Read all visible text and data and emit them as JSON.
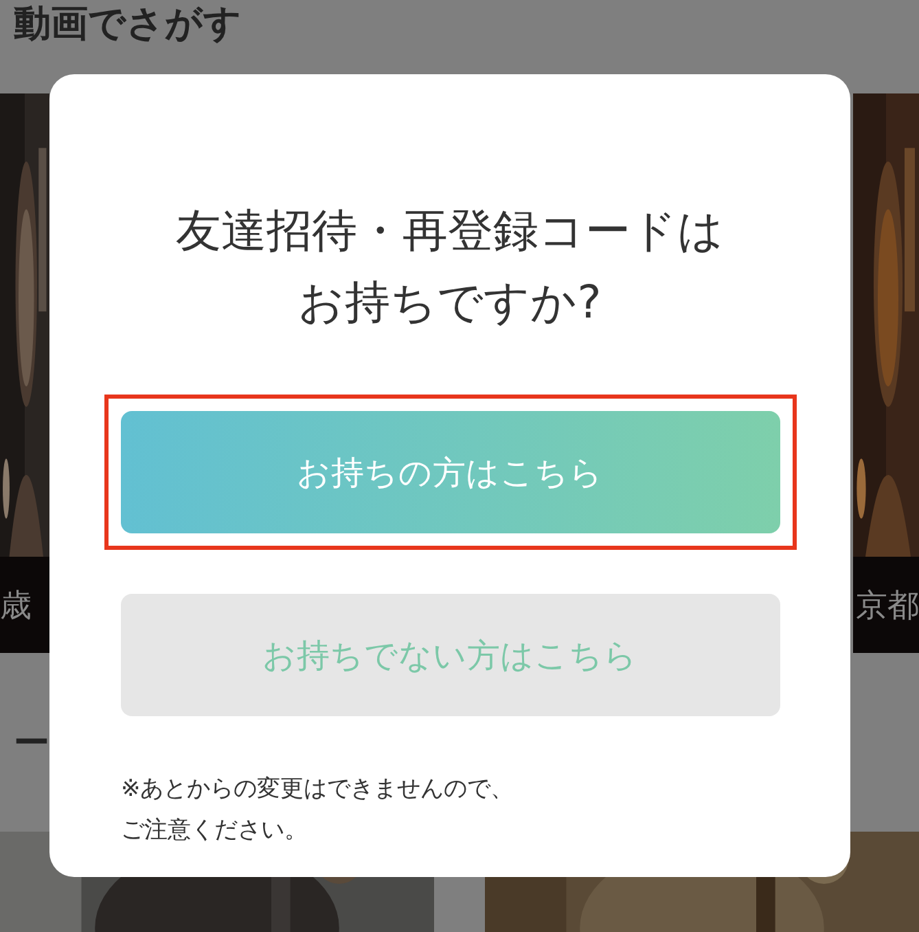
{
  "page": {
    "section_title": "動画でさがす",
    "cards": [
      {
        "caption": "歳"
      },
      {
        "caption": "京都"
      }
    ],
    "section_2_heading": "ー"
  },
  "modal": {
    "title_lines": [
      "友達招待・再登録コードは",
      "お持ちですか?"
    ],
    "buttons": [
      {
        "label": "お持ちの方はこちら",
        "kind": "primary",
        "highlighted": true
      },
      {
        "label": "お持ちでない方はこちら",
        "kind": "secondary",
        "highlighted": false
      }
    ],
    "note_lines": [
      "※あとからの変更はできませんので、",
      "ご注意ください。"
    ]
  }
}
